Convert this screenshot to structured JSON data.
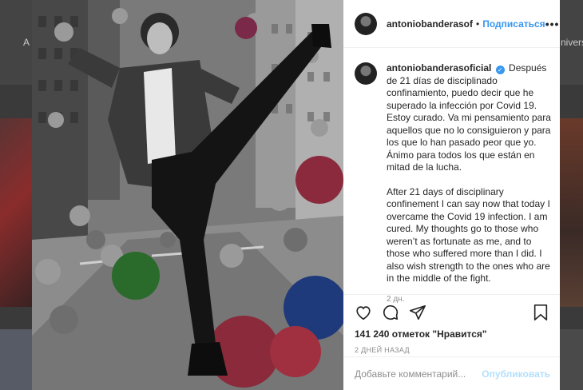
{
  "background": {
    "left_letter": "A",
    "right_text": "nivers"
  },
  "post": {
    "username": "antoniobanderasof",
    "follow_label": "Подписаться",
    "header_dot": "•",
    "more_label": "•••",
    "caption_user": "antoniobanderasoficial",
    "verified_mark": "✓",
    "caption_es": "Después de 21 días de disciplinado confinamiento, puedo decir que he superado la infección por Covid 19. Estoy curado. Va mi pensamiento para aquellos que no lo consiguieron y para los que lo han pasado peor que yo. Ánimo para todos los que están en mitad de la lucha.",
    "caption_en": "After 21 days of disciplinary confinement I can say now that today I overcame the Covid 19 infection. I am cured. My thoughts go to those who weren’t as fortunate as me, and to those who suffered more than I did. I also wish strength to the ones who are in the middle of the fight.",
    "caption_time": "2 дн.",
    "likes": "141 240 отметок \"Нравится\"",
    "date": "2 ДНЕЙ НАЗАД",
    "comment_placeholder": "Добавьте комментарий...",
    "publish_label": "Опубликовать"
  },
  "icons": {
    "like": "heart-icon",
    "comment": "speech-bubble-icon",
    "share": "paper-plane-icon",
    "save": "bookmark-icon"
  }
}
